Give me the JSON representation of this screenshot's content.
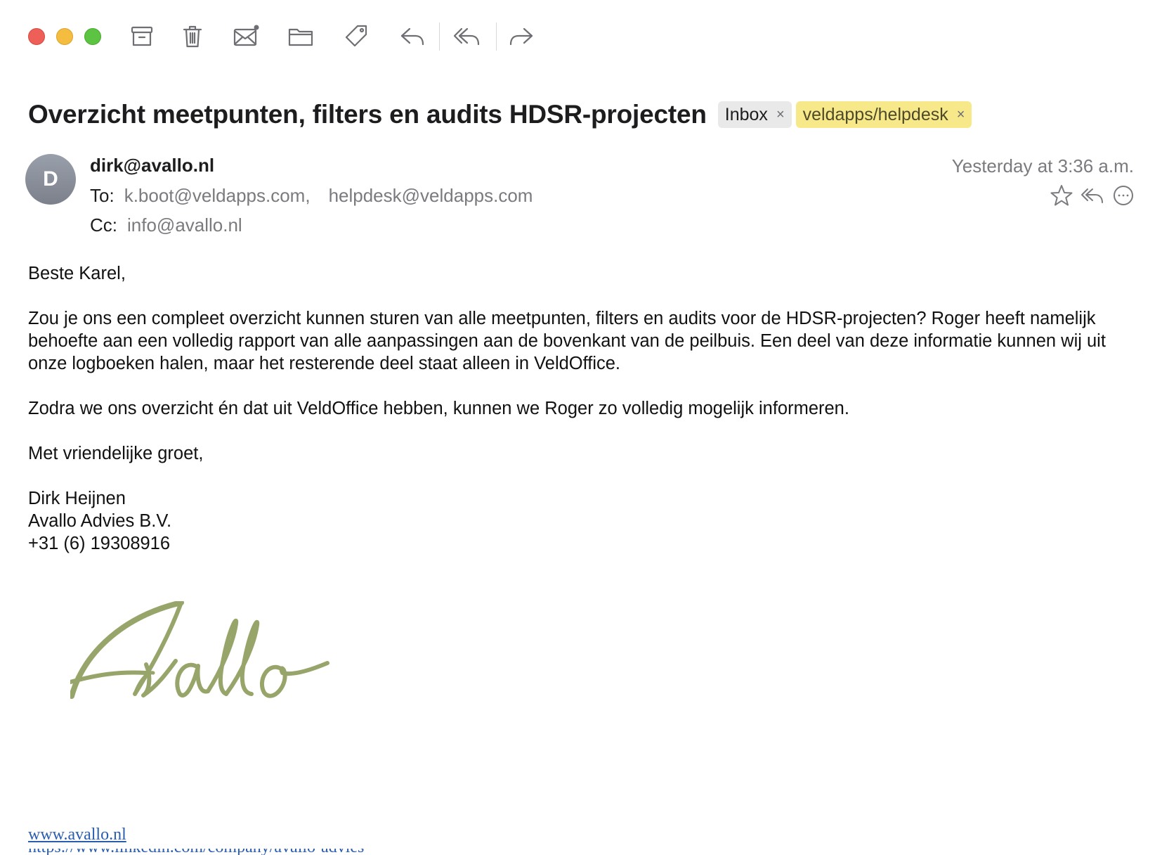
{
  "window": {
    "traffic_lights": [
      "close",
      "minimize",
      "zoom"
    ],
    "colors": {
      "close": "#ee5f57",
      "minimize": "#f4bd3f",
      "zoom": "#5dc342"
    }
  },
  "toolbar": {
    "icons": [
      "archive-icon",
      "trash-icon",
      "mail-unread-icon",
      "folder-icon",
      "tag-icon",
      "reply-icon",
      "reply-all-icon",
      "forward-icon"
    ]
  },
  "message": {
    "subject": "Overzicht meetpunten, filters en audits HDSR-projecten",
    "tags": [
      {
        "label": "Inbox",
        "remove": "×",
        "color": "#e9e9ea"
      },
      {
        "label": "veldapps/helpdesk",
        "remove": "×",
        "color": "#f7e98a"
      }
    ],
    "avatar_initial": "D",
    "from": "dirk@avallo.nl",
    "to_label": "To:",
    "to": [
      "k.boot@veldapps.com,",
      "helpdesk@veldapps.com"
    ],
    "cc_label": "Cc:",
    "cc": [
      "info@avallo.nl"
    ],
    "date": "Yesterday at 3:36 a.m.",
    "header_actions": [
      "star-icon",
      "reply-all-icon",
      "more-icon"
    ],
    "body": {
      "greeting": "Beste Karel,",
      "paragraph1": "Zou je ons een compleet overzicht kunnen sturen van alle meetpunten, filters en audits voor de HDSR-projecten? Roger heeft namelijk behoefte aan een volledig rapport van alle aanpassingen aan de bovenkant van de peilbuis. Een deel van deze informatie kunnen wij uit onze logboeken halen, maar het resterende deel staat alleen in VeldOffice.",
      "paragraph2": "Zodra we ons overzicht én dat uit VeldOffice hebben, kunnen we Roger zo volledig mogelijk informeren.",
      "closing": "Met vriendelijke groet,",
      "signature": [
        "Dirk Heijnen",
        "Avallo Advies B.V.",
        "+31 (6) 19308916"
      ],
      "logo_text": "Avallo",
      "logo_color": "#97a56a",
      "website_link": "www.avallo.nl",
      "cut_link": "https://www.linkedin.com/company/avallo-advies"
    }
  }
}
